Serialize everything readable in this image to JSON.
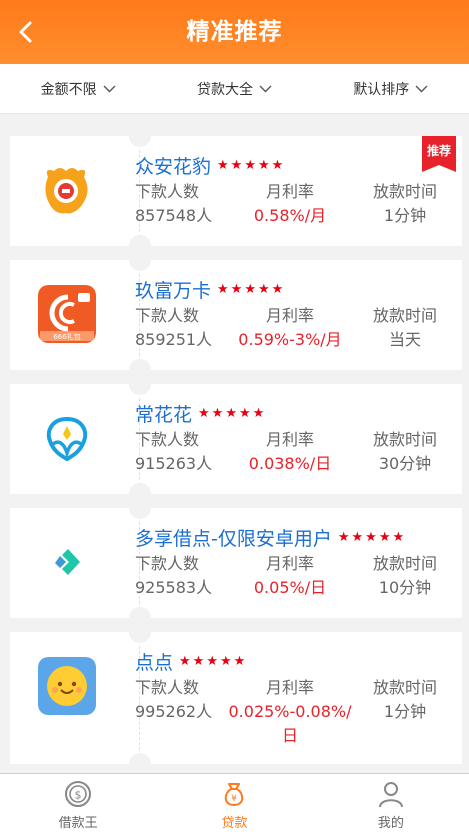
{
  "header": {
    "title": "精准推荐",
    "back_icon": "chevron-left-icon"
  },
  "filters": [
    {
      "label": "金额不限",
      "icon": "chevron-down-icon"
    },
    {
      "label": "贷款大全",
      "icon": "chevron-down-icon"
    },
    {
      "label": "默认排序",
      "icon": "chevron-down-icon"
    }
  ],
  "colors": {
    "accent": "#ff7a1a",
    "name": "#1b6fd2",
    "rate": "#e8222a",
    "star": "#e60012"
  },
  "column_labels": {
    "downloads": "下款人数",
    "rate": "月利率",
    "time": "放款时间"
  },
  "products": [
    {
      "name": "众安花豹",
      "stars": "★★★★★",
      "downloads": "857548人",
      "rate": "0.58%/月",
      "time": "1分钟",
      "badge": "推荐",
      "logo": "zhongan-logo"
    },
    {
      "name": "玖富万卡",
      "stars": "★★★★★",
      "downloads": "859251人",
      "rate": "0.59%-3%/月",
      "time": "当天",
      "logo": "jiufu-logo",
      "logo_text": "666礼包"
    },
    {
      "name": "常花花",
      "stars": "★★★★★",
      "downloads": "915263人",
      "rate": "0.038%/日",
      "time": "30分钟",
      "logo": "changhuahua-logo"
    },
    {
      "name": "多享借点-仅限安卓用户",
      "stars": "★★★★★",
      "downloads": "925583人",
      "rate": "0.05%/日",
      "time": "10分钟",
      "logo": "duoxiang-logo"
    },
    {
      "name": "点点",
      "stars": "★★★★★",
      "downloads": "995262人",
      "rate": "0.025%-0.08%/日",
      "time": "1分钟",
      "logo": "diandian-logo"
    }
  ],
  "tabbar": [
    {
      "label": "借款王",
      "icon": "coin-icon",
      "active": false
    },
    {
      "label": "贷款",
      "icon": "money-bag-icon",
      "active": true
    },
    {
      "label": "我的",
      "icon": "user-icon",
      "active": false
    }
  ]
}
